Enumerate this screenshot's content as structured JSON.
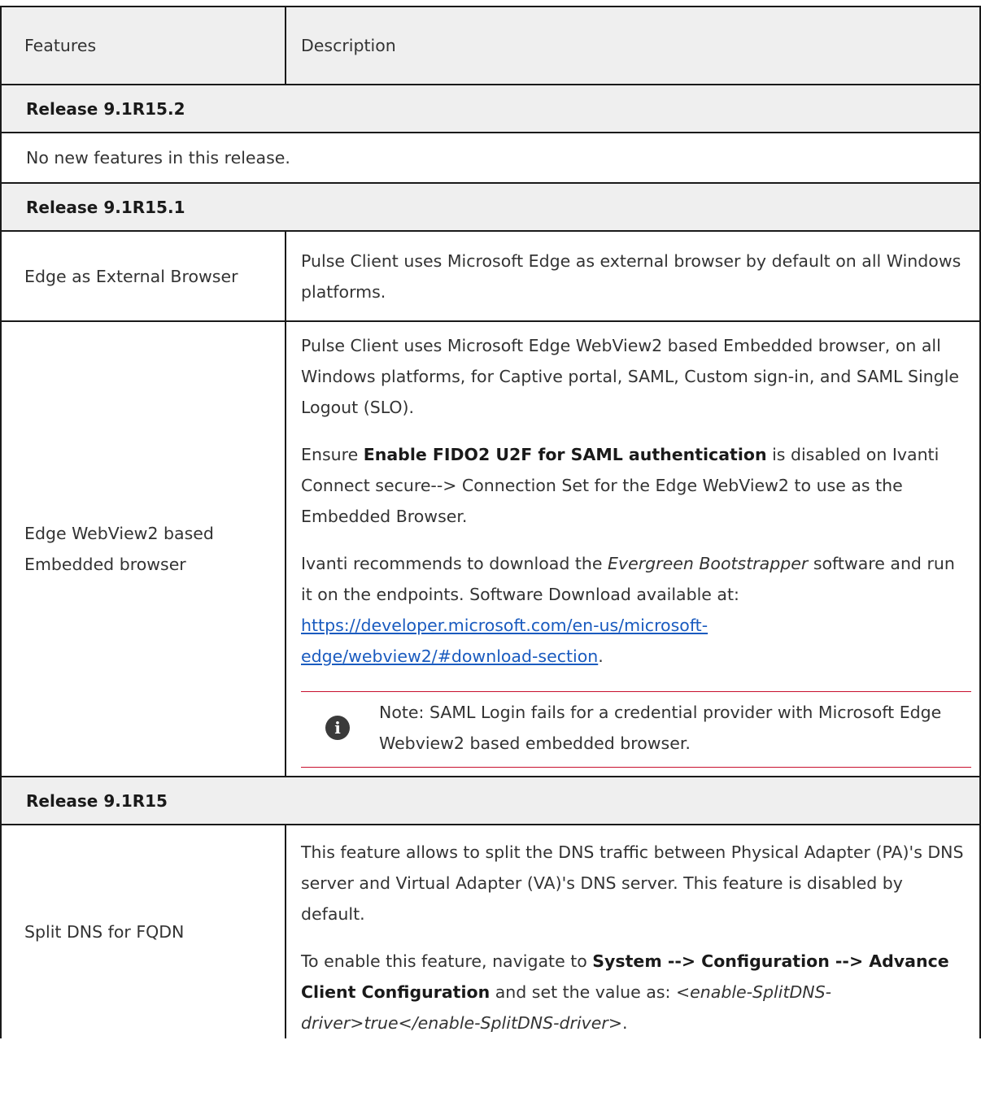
{
  "table": {
    "header": {
      "features": "Features",
      "description": "Description"
    },
    "sections": [
      {
        "release": "Release 9.1R15.2",
        "message": "No new features in this release."
      },
      {
        "release": "Release 9.1R15.1",
        "rows": [
          {
            "feature": "Edge as External Browser",
            "description": "Pulse Client uses Microsoft Edge as external browser by default on all Windows platforms."
          },
          {
            "feature_line1": "Edge WebView2 based",
            "feature_line2": "Embedded browser",
            "p1": "Pulse Client uses Microsoft Edge WebView2 based Embedded browser, on all Windows platforms, for Captive portal, SAML, Custom sign-in, and SAML Single Logout (SLO).",
            "p2_pre": "Ensure ",
            "p2_bold": "Enable FIDO2 U2F for SAML authentication",
            "p2_post": " is disabled on Ivanti Connect secure--> Connection Set for the Edge WebView2 to use as the Embedded Browser.",
            "p3_pre": "Ivanti recommends to download the ",
            "p3_italic": "Evergreen Bootstrapper",
            "p3_post": " software and run it on the endpoints. Software Download available at: ",
            "p3_link": "https://developer.microsoft.com/en-us/microsoft-edge/webview2/#download-section",
            "p3_end": ".",
            "note": "Note: SAML Login fails for a credential provider with Microsoft Edge Webview2 based embedded browser."
          }
        ]
      },
      {
        "release": "Release 9.1R15",
        "rows": [
          {
            "feature": "Split DNS for FQDN",
            "p1": "This feature allows to split the DNS traffic between Physical Adapter (PA)'s DNS server and Virtual Adapter (VA)'s DNS server. This feature is disabled by default.",
            "p2_pre": "To enable this feature, navigate to ",
            "p2_bold": "System --> Configuration --> Advance Client Configuration",
            "p2_mid": " and set the value as: ",
            "p2_italic": "<enable-SplitDNS-driver>true</enable-SplitDNS-driver>",
            "p2_end": "."
          }
        ]
      }
    ]
  },
  "icons": {
    "note": "info-icon"
  },
  "colors": {
    "link": "#1a5bbf",
    "note_rule": "#c8102e",
    "header_bg": "#efefef"
  }
}
